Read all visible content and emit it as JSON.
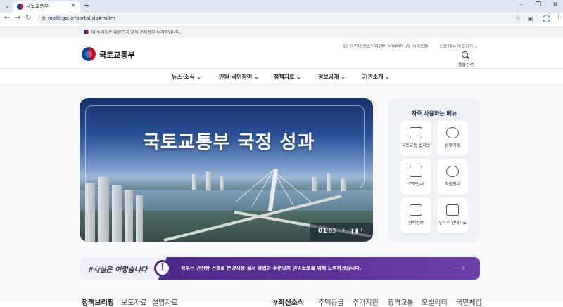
{
  "browser": {
    "tab_title": "국토교통부",
    "tab_close": "×",
    "new_tab": "+",
    "tab_menu": "⌄",
    "window_controls": [
      "–",
      "❐",
      "✕"
    ],
    "url": "molit.go.kr/portal.do#mltm",
    "nav": {
      "back": "←",
      "forward": "→",
      "reload": "↻"
    },
    "star": "☆",
    "more": "⋮"
  },
  "gov_banner": {
    "text": "이 누리집은 대한민국 공식 전자정부 누리집입니다."
  },
  "header": {
    "logo_text": "국토교통부",
    "utils": [
      {
        "icon": "child-icon",
        "label": "어린이 청소년마당"
      },
      {
        "icon": "globe-icon",
        "label": "English"
      },
      {
        "icon": "sitemap-icon",
        "label": "사이트맵"
      }
    ],
    "quick_menu": "소셜 메뉴 바로가기 ⌄",
    "search_label": "통합검색"
  },
  "gnb": [
    "뉴스·소식 ⌄",
    "민원·국민참여 ⌄",
    "정책자료 ⌄",
    "정보공개 ⌄",
    "기관소개 ⌄"
  ],
  "hero": {
    "title": "국토교통부 국정 성과",
    "counter_current": "01",
    "counter_total": "·03",
    "prev": "‹",
    "pause": "❚❚",
    "next": "›"
  },
  "freq_menu": {
    "title": "자주 사용하는 메뉴",
    "items": [
      "국토교통 법지보",
      "업무계획",
      "조직안내",
      "직원안내",
      "정책정보",
      "우리부 안내지도"
    ]
  },
  "fact_banner": {
    "left": "#사실은 이렇습니다",
    "excl": "!",
    "text": "정부는 건전한 건축물 분양시장 질서 확립과 수분양자 권익보호를 위해 노력하겠습니다."
  },
  "bottom_tabs": [
    "정책브리핑",
    "보도자료",
    "설명자료",
    "#최신소식",
    "주택공급",
    "추가지원",
    "광역교통",
    "모빌리티",
    "국민체감"
  ]
}
